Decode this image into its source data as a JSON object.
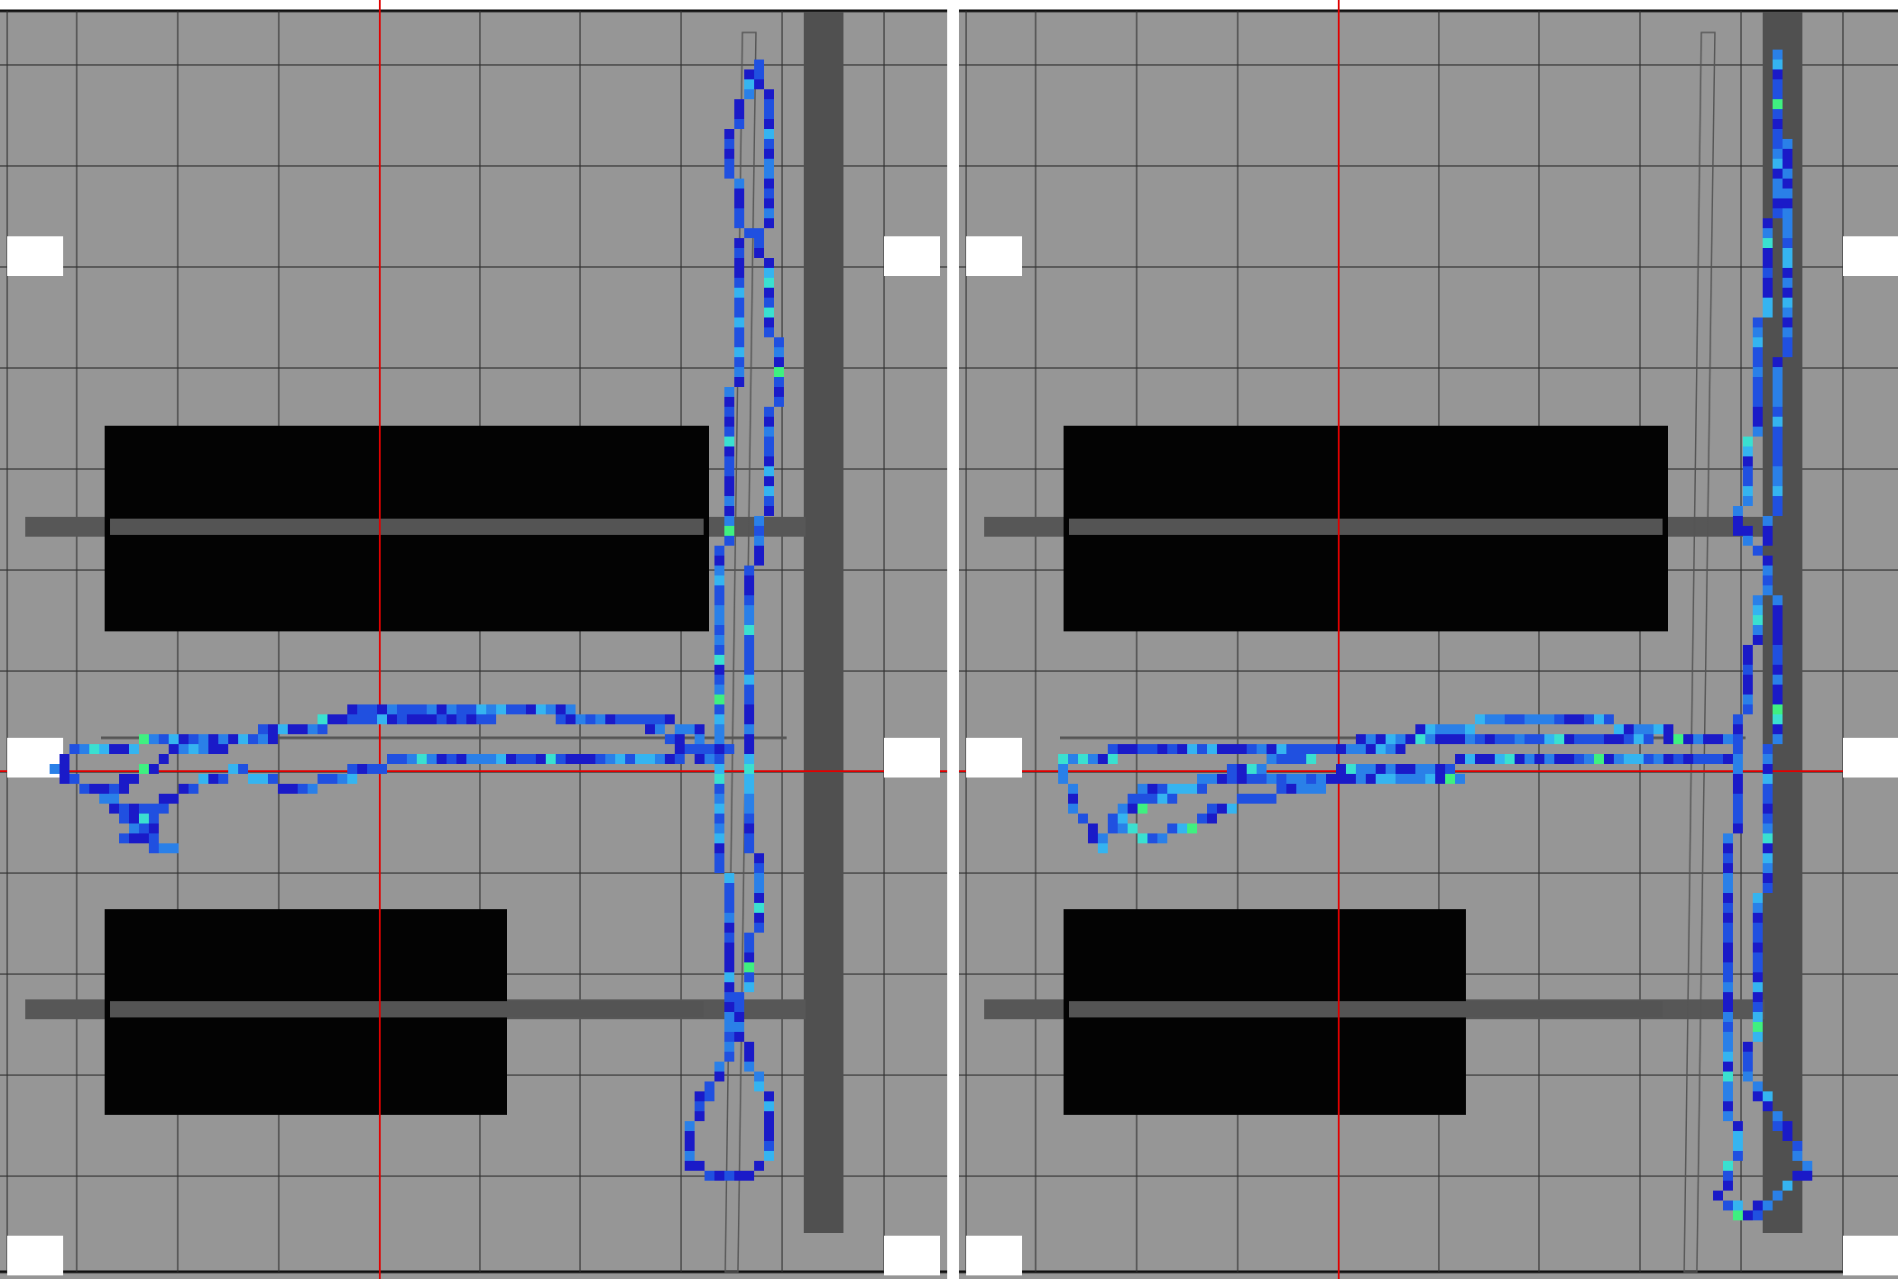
{
  "app": {
    "title": ""
  },
  "colors": {
    "background": "#969696",
    "grid_line": "#333333",
    "crosshair": "#e00000",
    "shelf_block": "#030303",
    "rack_bar": "#575757",
    "wall": "#505050",
    "marker": "#ffffff",
    "track_scale": [
      "#1a1ac8",
      "#2050e0",
      "#2a80e8",
      "#35b4f0",
      "#3ae0d0",
      "#3ff080"
    ]
  },
  "panels": [
    {
      "id": "left",
      "label": "left-map-view",
      "track": "ns_then_ew"
    },
    {
      "id": "right",
      "label": "right-map-view",
      "track": "ns_then_ew_variant"
    }
  ],
  "icons": {
    "marker": "white-marker-icon",
    "crosshair": "crosshair-icon"
  }
}
